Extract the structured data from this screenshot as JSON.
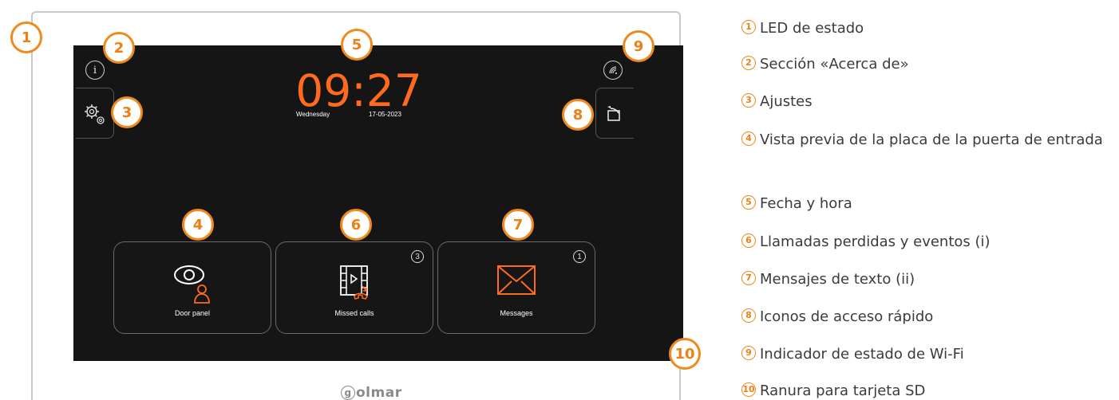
{
  "screen": {
    "time": "09:27",
    "day": "Wednesday",
    "date": "17-05-2023",
    "info_icon": "info-icon",
    "wifi_icon": "wifi-status-icon",
    "tiles": [
      {
        "label": "Door panel",
        "badge": null
      },
      {
        "label": "Missed calls",
        "badge": "3"
      },
      {
        "label": "Messages",
        "badge": "1"
      }
    ],
    "accent_color": "#ff6a1f"
  },
  "brand": {
    "logo_text": "golmar"
  },
  "callouts": [
    "1",
    "2",
    "3",
    "4",
    "5",
    "6",
    "7",
    "8",
    "9",
    "10"
  ],
  "legend": [
    {
      "num": "1",
      "text": "LED de estado"
    },
    {
      "num": "2",
      "text": "Sección «Acerca de»"
    },
    {
      "num": "3",
      "text": "Ajustes"
    },
    {
      "num": "4",
      "text": "Vista previa de la placa de la puerta de entrada"
    },
    {
      "num": "5",
      "text": "Fecha y hora"
    },
    {
      "num": "6",
      "text": "Llamadas perdidas y eventos (i)"
    },
    {
      "num": "7",
      "text": "Mensajes de texto (ii)"
    },
    {
      "num": "8",
      "text": "Iconos de acceso rápido"
    },
    {
      "num": "9",
      "text": "Indicador de estado de Wi-Fi"
    },
    {
      "num": "10",
      "text": "Ranura para tarjeta SD"
    }
  ]
}
